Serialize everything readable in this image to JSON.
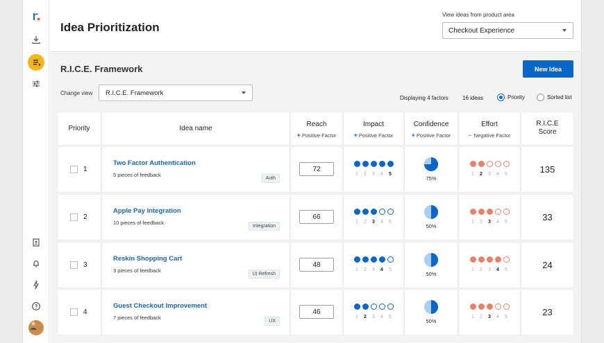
{
  "header": {
    "title": "Idea Prioritization",
    "area_label": "View ideas from product area",
    "area_value": "Checkout Experience"
  },
  "toolbar": {
    "section_title": "R.I.C.E. Framework",
    "new_idea_label": "New Idea",
    "change_view_label": "Change view",
    "change_view_value": "R.I.C.E. Framework",
    "displaying": "Displaying 4 factors",
    "ideas_count": "16 ideas",
    "priority_label": "Priority",
    "sorted_label": "Sorted list",
    "selected_mode": "priority"
  },
  "columns": {
    "priority": "Priority",
    "idea_name": "Idea name",
    "reach": "Reach",
    "reach_sub": "Positive Factor",
    "impact": "Impact",
    "impact_sub": "Positive Factor",
    "confidence": "Confidence",
    "confidence_sub": "Positive Factor",
    "effort": "Effort",
    "effort_sub": "Negative Factor",
    "score_line1": "R.I.C.E",
    "score_line2": "Score"
  },
  "scale_labels": [
    "1",
    "2",
    "3",
    "4",
    "5"
  ],
  "colors": {
    "accent": "#0b66c9",
    "impact": "#0b66c9",
    "effort": "#e8816a",
    "logo_dot": "#f05a47",
    "nav_active": "#f3b51b"
  },
  "rows": [
    {
      "priority": "1",
      "name": "Two Factor Authentication",
      "feedback": "5 pieces of feedback",
      "tag": "Auth",
      "reach": "72",
      "impact": 5,
      "confidence": 0.75,
      "confidence_label": "75%",
      "effort": 2,
      "score": "135"
    },
    {
      "priority": "2",
      "name": "Apple Pay Integration",
      "feedback": "10 pieces of feedback",
      "tag": "Integration",
      "reach": "66",
      "impact": 3,
      "confidence": 0.5,
      "confidence_label": "50%",
      "effort": 3,
      "score": "33"
    },
    {
      "priority": "3",
      "name": "Reskin Shopping Cart",
      "feedback": "3 pieces of feedback",
      "tag": "UI Refresh",
      "reach": "48",
      "impact": 4,
      "confidence": 0.5,
      "confidence_label": "50%",
      "effort": 4,
      "score": "24"
    },
    {
      "priority": "4",
      "name": "Guest Checkout Improvement",
      "feedback": "7 pieces of feedback",
      "tag": "UX",
      "reach": "46",
      "impact": 2,
      "confidence": 0.5,
      "confidence_label": "50%",
      "effort": 3,
      "score": "23"
    }
  ],
  "nav_icons": [
    "logo-icon",
    "download-icon",
    "ideas-icon",
    "sliders-icon",
    "contacts-icon",
    "bell-icon",
    "bolt-icon",
    "help-icon",
    "avatar"
  ]
}
